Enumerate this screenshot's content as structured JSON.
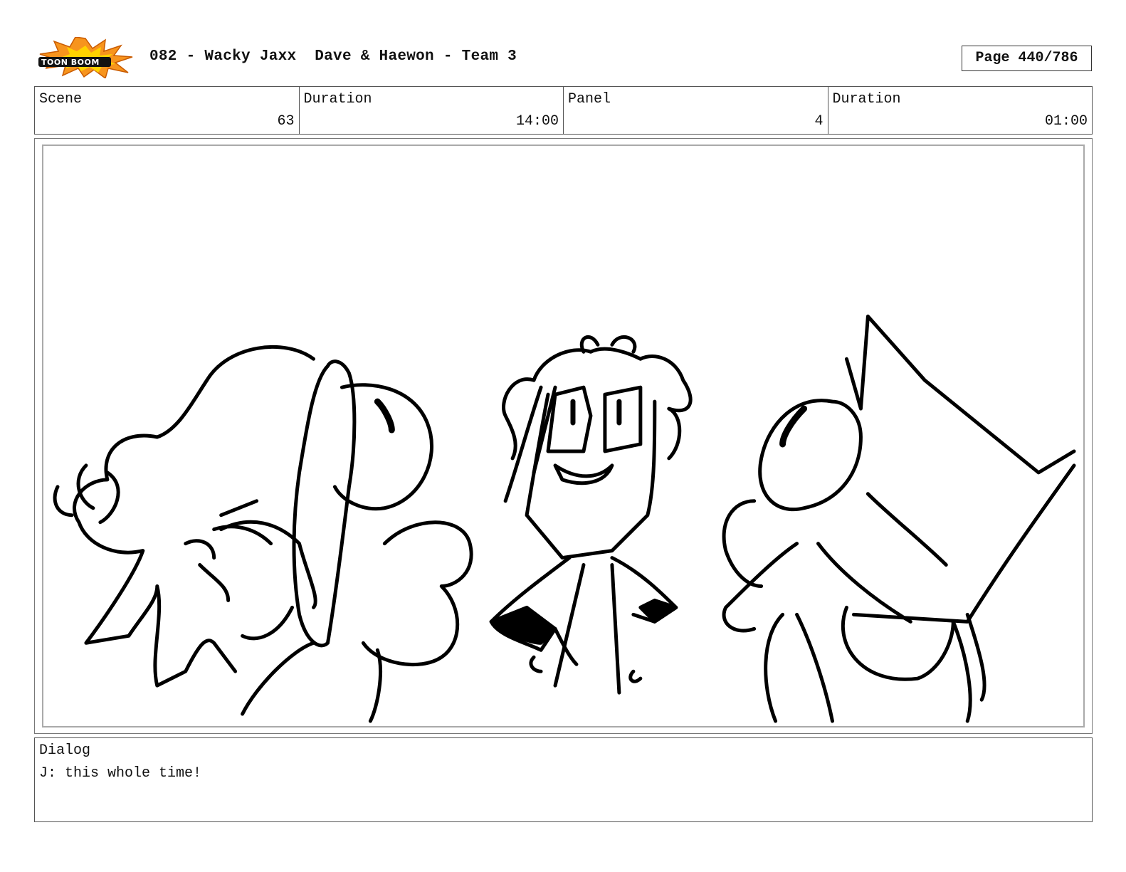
{
  "header": {
    "logo_text": "TOONBOOM",
    "title": "082 - Wacky Jaxx  Dave & Haewon - Team 3",
    "page": "Page 440/786"
  },
  "info": {
    "scene_label": "Scene",
    "scene_value": "63",
    "duration_label": "Duration",
    "duration_value": "14:00",
    "panel_label": "Panel",
    "panel_value": "4",
    "panel_duration_label": "Duration",
    "panel_duration_value": "01:00"
  },
  "dialog": {
    "label": "Dialog",
    "text": "J: this whole time!"
  },
  "colors": {
    "logo_burst": "#f7941d",
    "logo_inner": "#ffd200",
    "ink": "#000000"
  }
}
